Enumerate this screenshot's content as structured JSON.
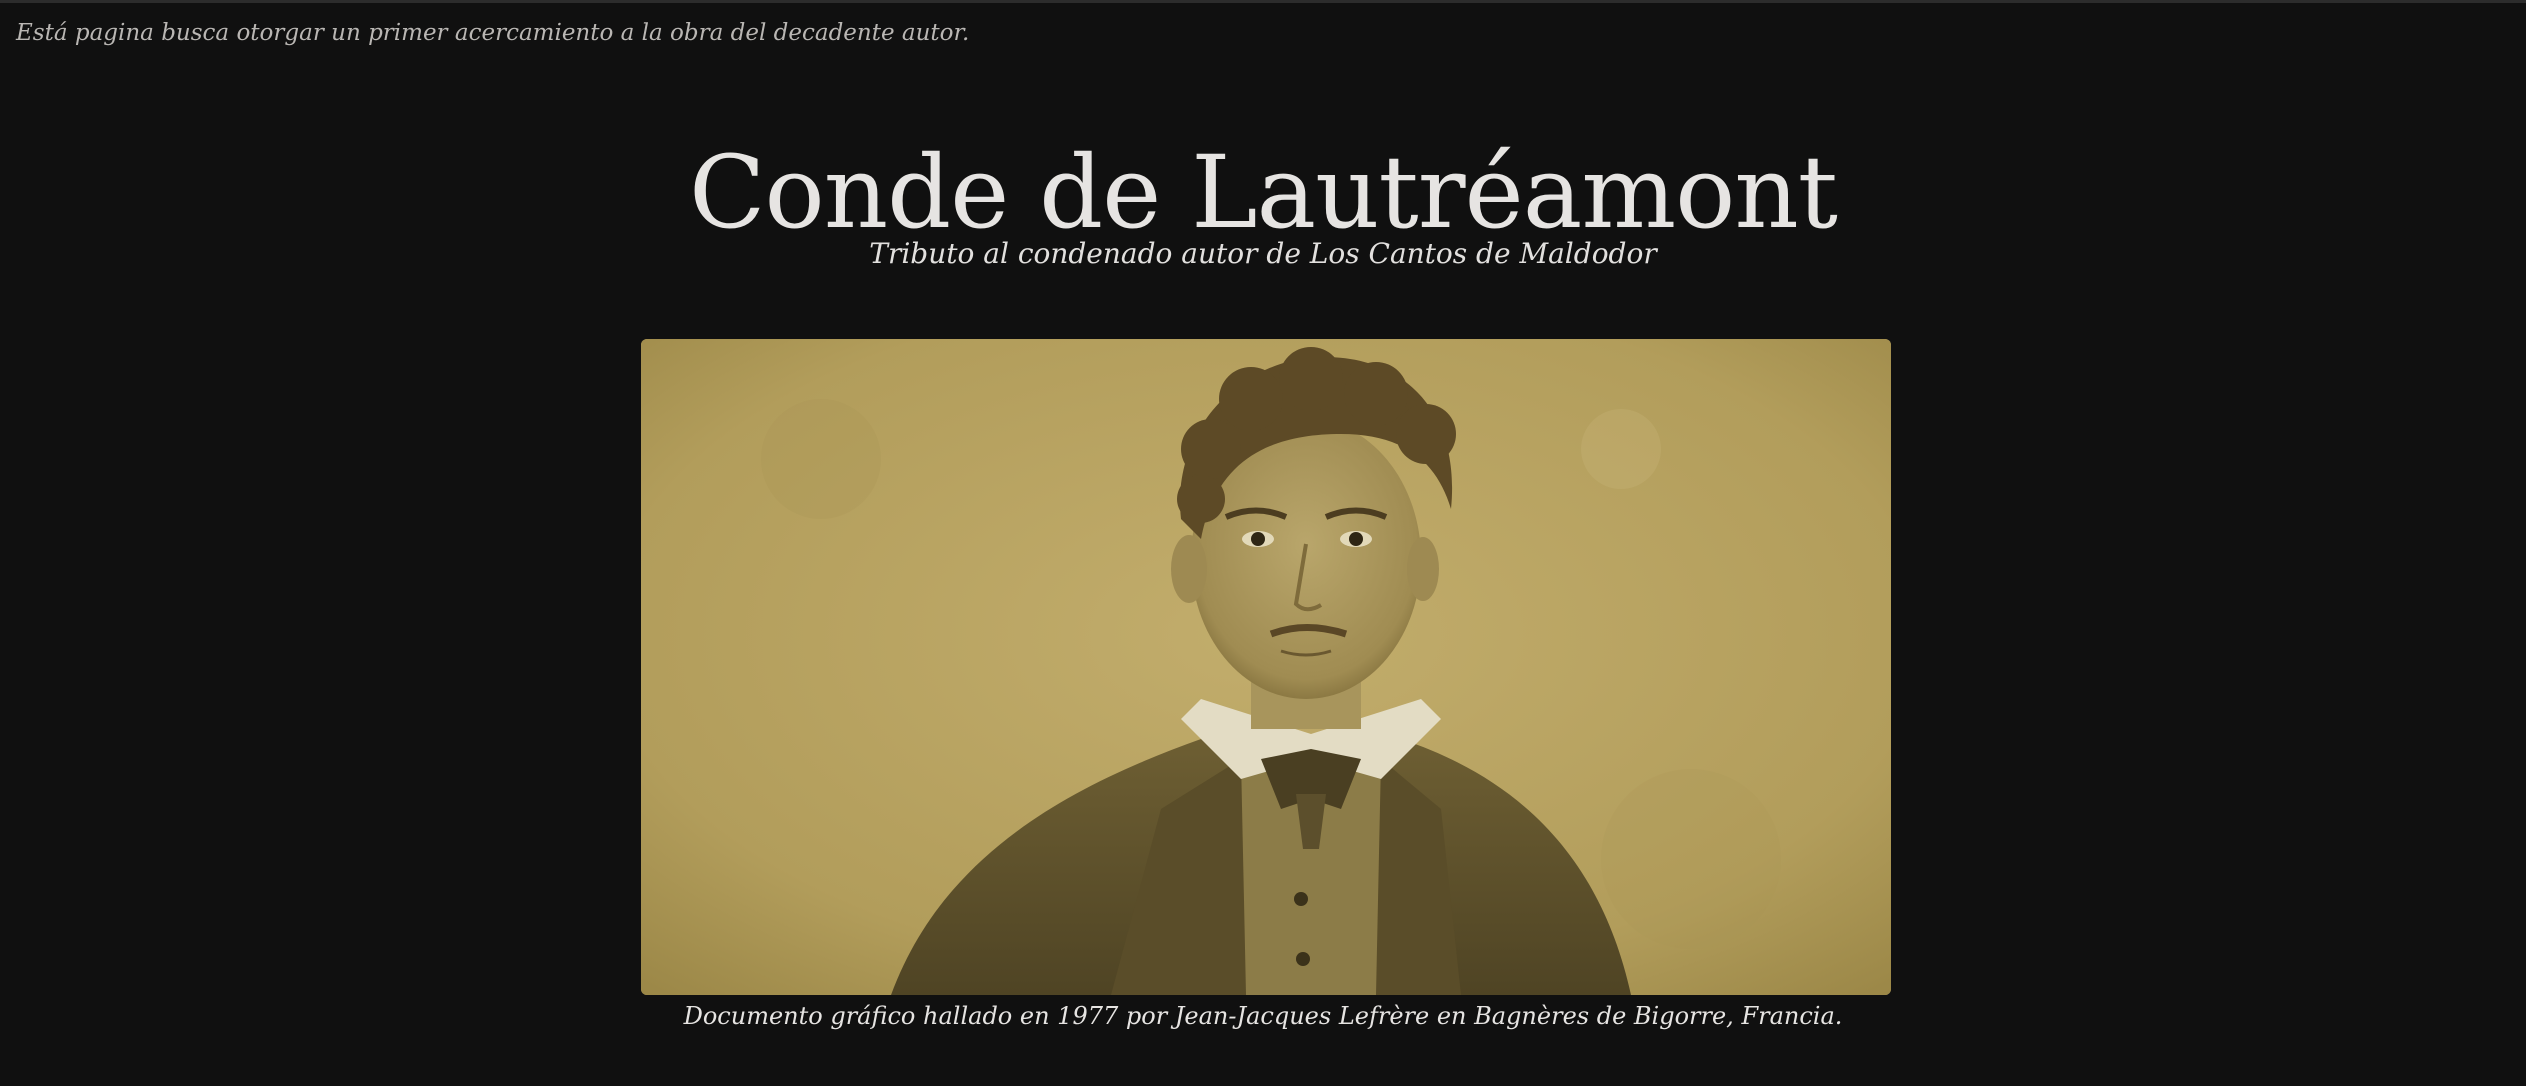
{
  "intro_text": "Está pagina busca otorgar un primer acercamiento a la obra del decadente autor.",
  "header": {
    "title": "Conde de Lautréamont",
    "subtitle": "Tributo al condenado autor de Los Cantos de Maldodor"
  },
  "figure": {
    "image_alt": "Retrato sepia de Isidore Ducasse",
    "caption": "Documento gráfico hallado en 1977 por Jean-Jacques Lefrère en Bagnères de Bigorre, Francia."
  },
  "colors": {
    "background": "#101010",
    "text": "#e4e2e0",
    "sepia": "#b5a05e"
  }
}
